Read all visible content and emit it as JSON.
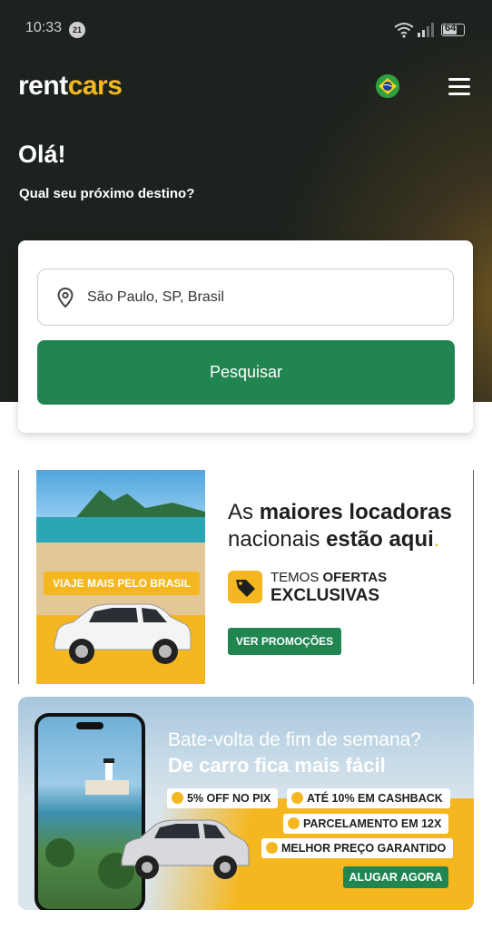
{
  "status_bar": {
    "time": "10:33",
    "notif_badge": "21",
    "battery": "64"
  },
  "header": {
    "logo_part1": "rent",
    "logo_part2": "cars",
    "flag": "brazil-flag-icon",
    "menu_icon": "hamburger-menu-icon"
  },
  "hero": {
    "greeting": "Olá!",
    "subtitle": "Qual seu próximo destino?"
  },
  "search": {
    "value": "São Paulo, SP, Brasil",
    "button_label": "Pesquisar"
  },
  "banner1": {
    "tag": "VIAJE MAIS PELO BRASIL",
    "headline_part1": "As ",
    "headline_bold1": "maiores locadoras",
    "headline_part2": "nacionais ",
    "headline_bold2": "estão aqui",
    "headline_dot": ".",
    "offer_line1_a": "TEMOS ",
    "offer_line1_b": "OFERTAS",
    "offer_line2": "EXCLUSIVAS",
    "button_label": "VER PROMOÇÕES"
  },
  "banner2": {
    "title_line1": "Bate-volta de fim de semana?",
    "title_line2": "De carro fica mais fácil",
    "pills": [
      "5% OFF NO PIX",
      "ATÉ 10% EM CASHBACK",
      "PARCELAMENTO EM 12X",
      "MELHOR PREÇO GARANTIDO"
    ],
    "button_label": "ALUGAR AGORA"
  },
  "colors": {
    "brand_green": "#218551",
    "brand_yellow": "#f5b71f",
    "hero_bg": "#1c221d"
  }
}
